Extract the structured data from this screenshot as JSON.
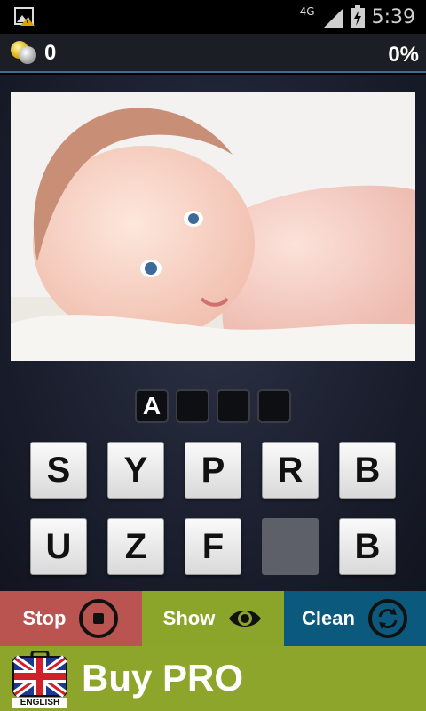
{
  "status_bar": {
    "network": "4G",
    "time": "5:39"
  },
  "top_bar": {
    "coins": "0",
    "progress": "0%"
  },
  "puzzle": {
    "image_icon": "baby-photo",
    "answer_slots": [
      "A",
      "",
      "",
      ""
    ]
  },
  "letter_keys": {
    "row1": [
      "S",
      "Y",
      "P",
      "R",
      "B"
    ],
    "row2": [
      "U",
      "Z",
      "F",
      "",
      "B"
    ]
  },
  "actions": {
    "stop_label": "Stop",
    "show_label": "Show",
    "clean_label": "Clean"
  },
  "buy": {
    "label": "Buy PRO",
    "language_label": "ENGLISH"
  },
  "colors": {
    "stop": "#b95451",
    "show": "#8ba52a",
    "clean": "#0b5a7e",
    "buy_bar": "#8ca52a"
  }
}
